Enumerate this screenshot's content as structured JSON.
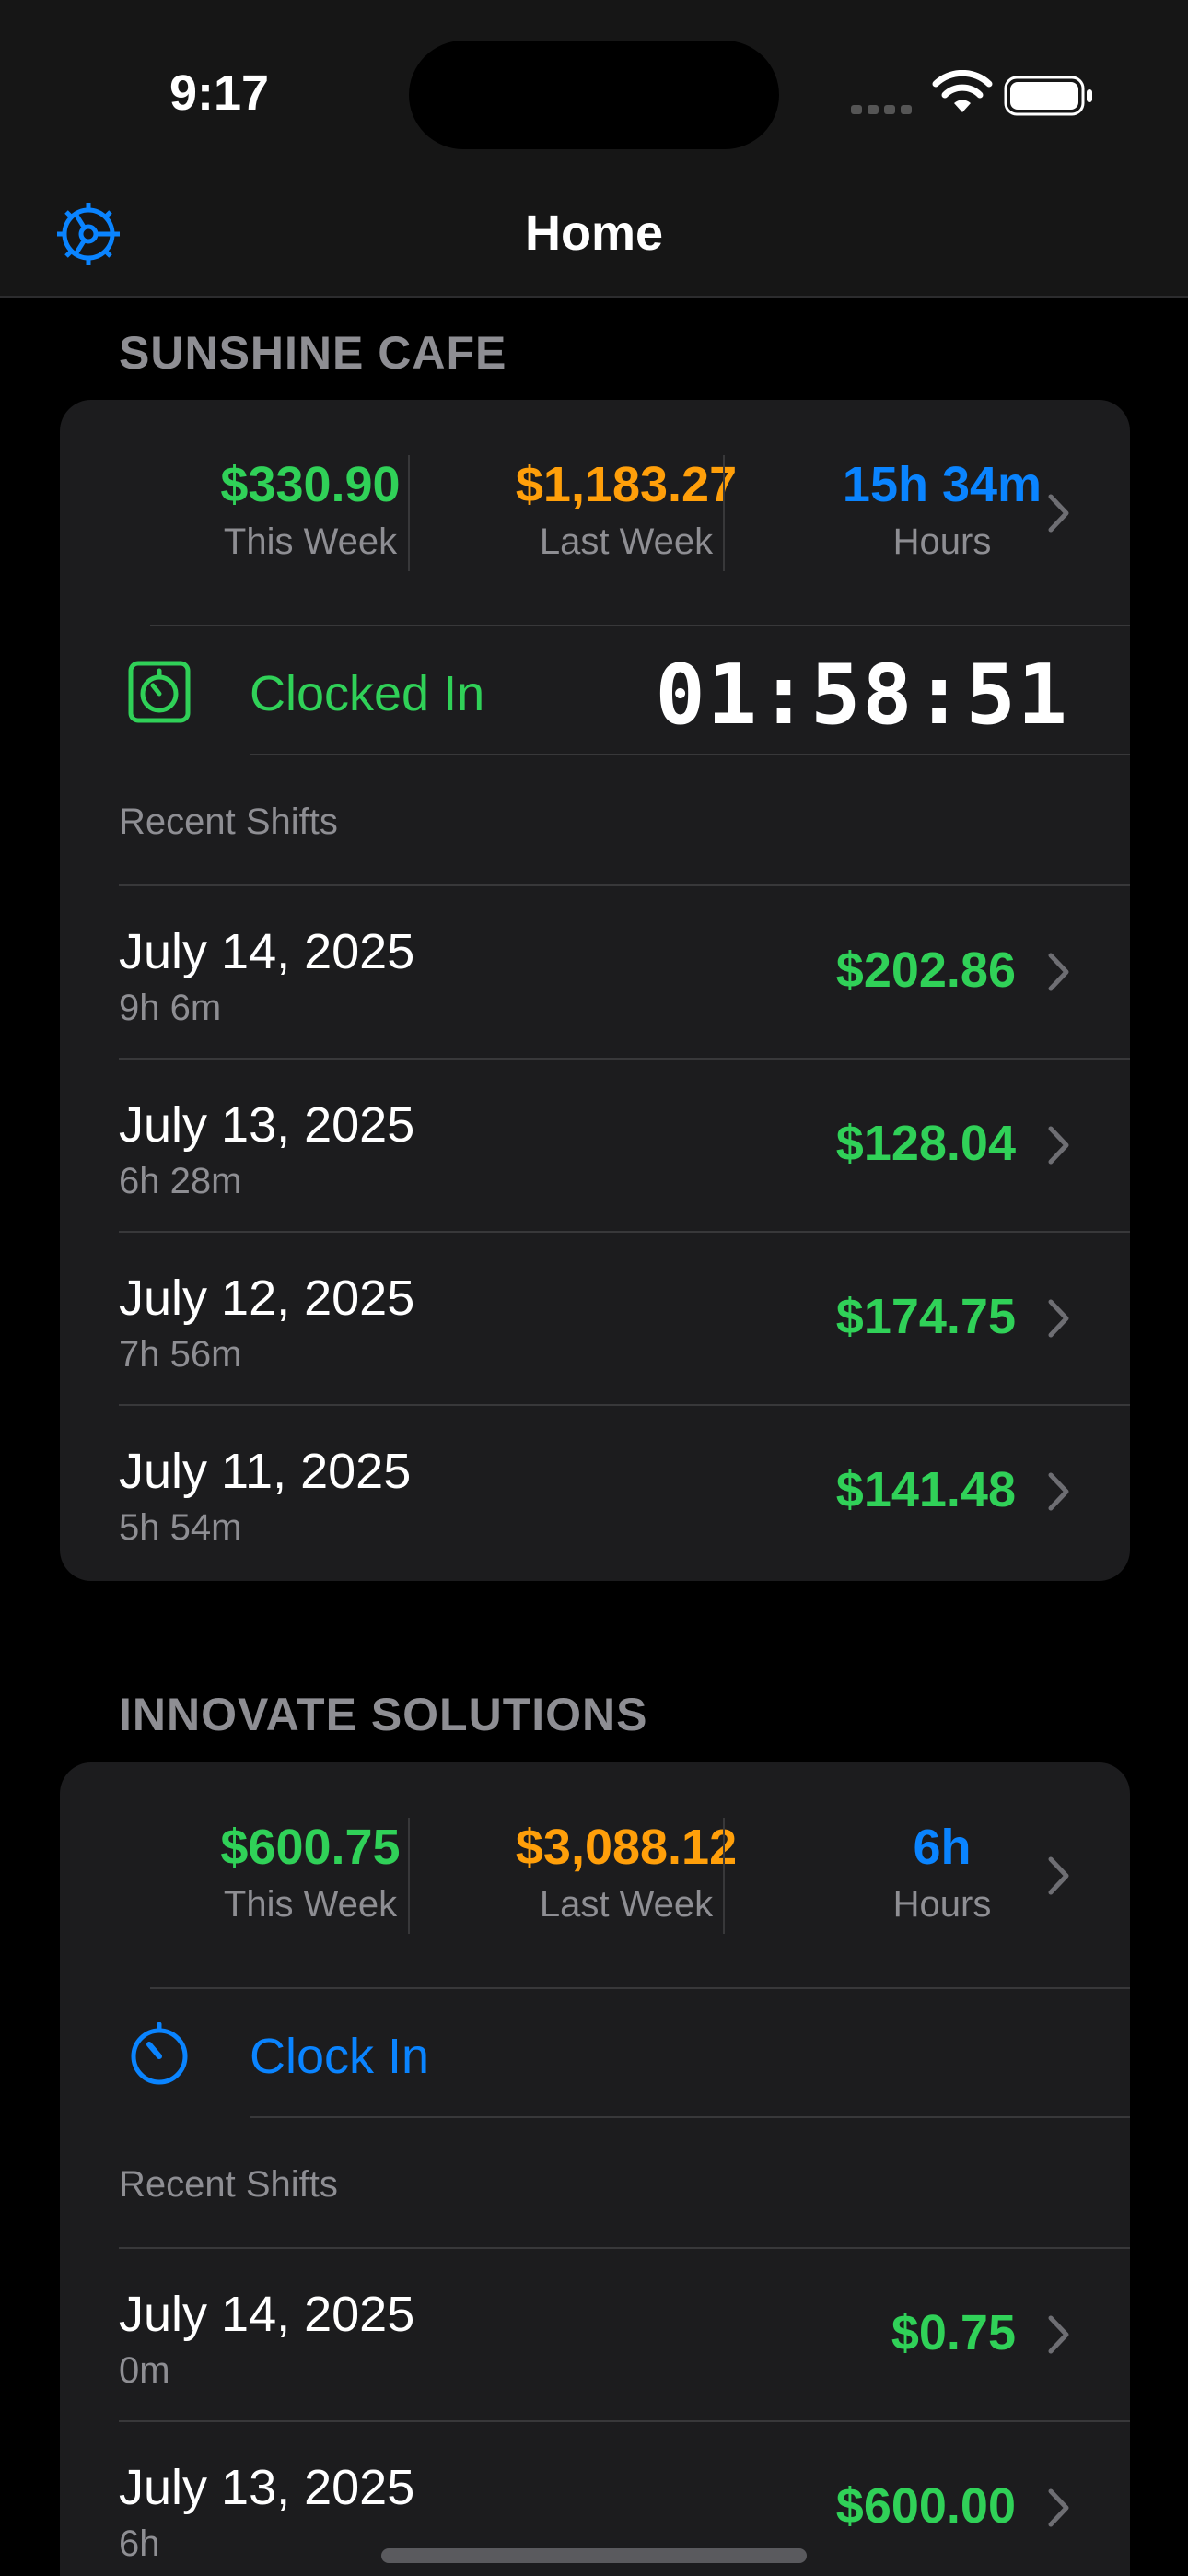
{
  "status_bar": {
    "time": "9:17"
  },
  "nav": {
    "title": "Home",
    "left_icon": "gear-icon"
  },
  "colors": {
    "green": "#30d158",
    "orange": "#ff9f0a",
    "blue": "#0a84ff",
    "card_bg": "#1c1c1e",
    "secondary_text": "#8e8e93"
  },
  "jobs": [
    {
      "name": "SUNSHINE CAFE",
      "this_week": "$330.90",
      "this_week_label": "This Week",
      "last_week": "$1,183.27",
      "last_week_label": "Last Week",
      "hours": "15h 34m",
      "hours_label": "Hours",
      "clock_status": "Clocked In",
      "timer": "01:58:51",
      "recent_label": "Recent Shifts",
      "shifts": [
        {
          "date": "July 14, 2025",
          "duration": "9h 6m",
          "amount": "$202.86"
        },
        {
          "date": "July 13, 2025",
          "duration": "6h 28m",
          "amount": "$128.04"
        },
        {
          "date": "July 12, 2025",
          "duration": "7h 56m",
          "amount": "$174.75"
        },
        {
          "date": "July 11, 2025",
          "duration": "5h 54m",
          "amount": "$141.48"
        }
      ]
    },
    {
      "name": "INNOVATE SOLUTIONS",
      "this_week": "$600.75",
      "this_week_label": "This Week",
      "last_week": "$3,088.12",
      "last_week_label": "Last Week",
      "hours": "6h",
      "hours_label": "Hours",
      "clock_status": "Clock In",
      "recent_label": "Recent Shifts",
      "shifts": [
        {
          "date": "July 14, 2025",
          "duration": "0m",
          "amount": "$0.75"
        },
        {
          "date": "July 13, 2025",
          "duration": "6h",
          "amount": "$600.00"
        }
      ]
    }
  ]
}
